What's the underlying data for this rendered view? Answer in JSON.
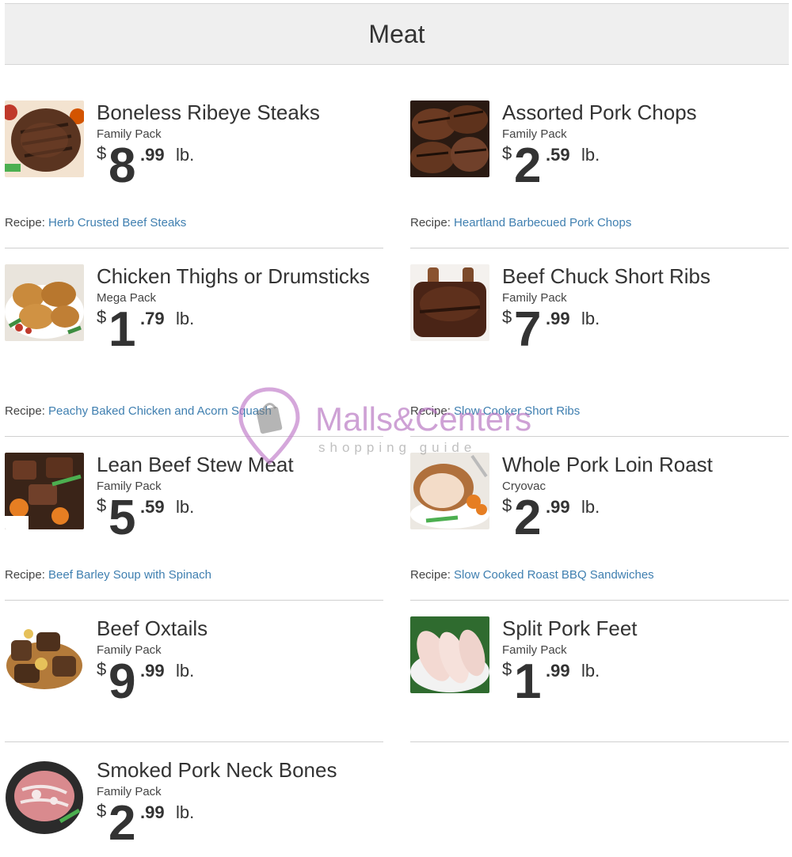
{
  "header": {
    "title": "Meat"
  },
  "items": [
    {
      "title": "Boneless Ribeye Steaks",
      "pack": "Family Pack",
      "dollar": "$",
      "whole": "8",
      "cents": ".99",
      "unit": "lb.",
      "recipe_label": "Recipe:",
      "recipe_link": "Herb Crusted Beef Steaks"
    },
    {
      "title": "Assorted Pork Chops",
      "pack": "Family Pack",
      "dollar": "$",
      "whole": "2",
      "cents": ".59",
      "unit": "lb.",
      "recipe_label": "Recipe:",
      "recipe_link": "Heartland Barbecued Pork Chops"
    },
    {
      "title": "Chicken Thighs or Drumsticks",
      "pack": "Mega Pack",
      "dollar": "$",
      "whole": "1",
      "cents": ".79",
      "unit": "lb.",
      "recipe_label": "Recipe:",
      "recipe_link": "Peachy Baked Chicken and Acorn Squash"
    },
    {
      "title": "Beef Chuck Short Ribs",
      "pack": "Family Pack",
      "dollar": "$",
      "whole": "7",
      "cents": ".99",
      "unit": "lb.",
      "recipe_label": "Recipe:",
      "recipe_link": "Slow Cooker Short Ribs"
    },
    {
      "title": "Lean Beef Stew Meat",
      "pack": "Family Pack",
      "dollar": "$",
      "whole": "5",
      "cents": ".59",
      "unit": "lb.",
      "recipe_label": "Recipe:",
      "recipe_link": "Beef Barley Soup with Spinach"
    },
    {
      "title": "Whole Pork Loin Roast",
      "pack": "Cryovac",
      "dollar": "$",
      "whole": "2",
      "cents": ".99",
      "unit": "lb.",
      "recipe_label": "Recipe:",
      "recipe_link": "Slow Cooked Roast BBQ Sandwiches"
    },
    {
      "title": "Beef Oxtails",
      "pack": "Family Pack",
      "dollar": "$",
      "whole": "9",
      "cents": ".99",
      "unit": "lb."
    },
    {
      "title": "Split Pork Feet",
      "pack": "Family Pack",
      "dollar": "$",
      "whole": "1",
      "cents": ".99",
      "unit": "lb."
    },
    {
      "title": "Smoked Pork Neck Bones",
      "pack": "Family Pack",
      "dollar": "$",
      "whole": "2",
      "cents": ".99",
      "unit": "lb."
    }
  ],
  "watermark": {
    "brand": "Malls&Centers",
    "tagline": "shopping guide"
  },
  "colors": {
    "link": "#3f7fb0",
    "header_bg": "#efefef",
    "watermark": "#b46ebe"
  }
}
